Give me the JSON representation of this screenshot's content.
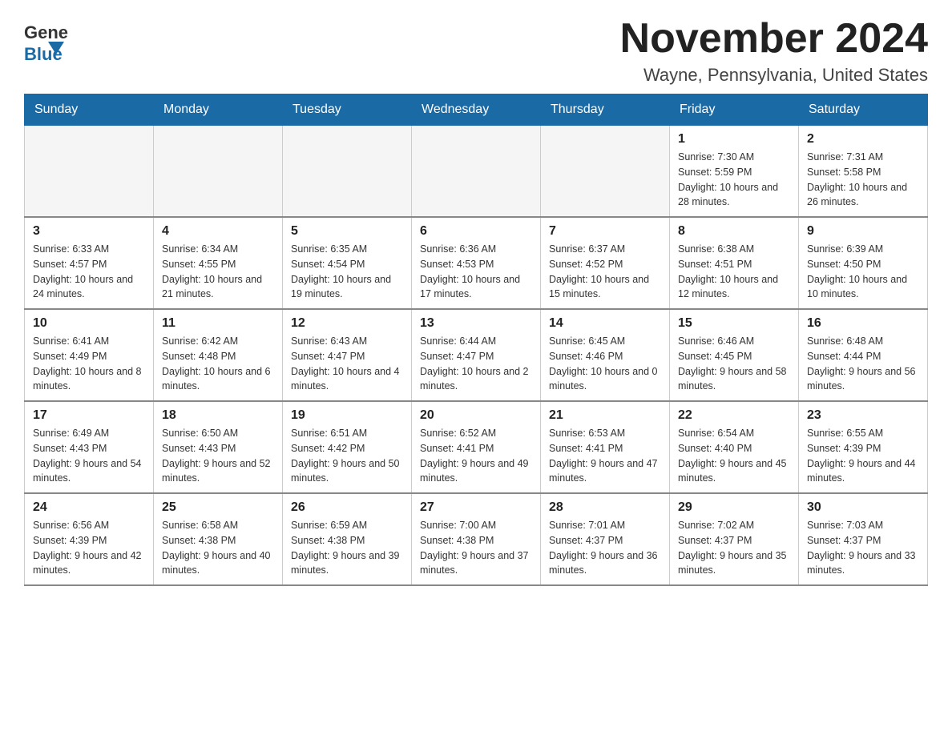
{
  "header": {
    "logo_general": "General",
    "logo_blue": "Blue",
    "month_title": "November 2024",
    "location": "Wayne, Pennsylvania, United States"
  },
  "days_of_week": [
    "Sunday",
    "Monday",
    "Tuesday",
    "Wednesday",
    "Thursday",
    "Friday",
    "Saturday"
  ],
  "weeks": [
    [
      {
        "day": "",
        "empty": true
      },
      {
        "day": "",
        "empty": true
      },
      {
        "day": "",
        "empty": true
      },
      {
        "day": "",
        "empty": true
      },
      {
        "day": "",
        "empty": true
      },
      {
        "day": "1",
        "sunrise": "7:30 AM",
        "sunset": "5:59 PM",
        "daylight": "10 hours and 28 minutes."
      },
      {
        "day": "2",
        "sunrise": "7:31 AM",
        "sunset": "5:58 PM",
        "daylight": "10 hours and 26 minutes."
      }
    ],
    [
      {
        "day": "3",
        "sunrise": "6:33 AM",
        "sunset": "4:57 PM",
        "daylight": "10 hours and 24 minutes."
      },
      {
        "day": "4",
        "sunrise": "6:34 AM",
        "sunset": "4:55 PM",
        "daylight": "10 hours and 21 minutes."
      },
      {
        "day": "5",
        "sunrise": "6:35 AM",
        "sunset": "4:54 PM",
        "daylight": "10 hours and 19 minutes."
      },
      {
        "day": "6",
        "sunrise": "6:36 AM",
        "sunset": "4:53 PM",
        "daylight": "10 hours and 17 minutes."
      },
      {
        "day": "7",
        "sunrise": "6:37 AM",
        "sunset": "4:52 PM",
        "daylight": "10 hours and 15 minutes."
      },
      {
        "day": "8",
        "sunrise": "6:38 AM",
        "sunset": "4:51 PM",
        "daylight": "10 hours and 12 minutes."
      },
      {
        "day": "9",
        "sunrise": "6:39 AM",
        "sunset": "4:50 PM",
        "daylight": "10 hours and 10 minutes."
      }
    ],
    [
      {
        "day": "10",
        "sunrise": "6:41 AM",
        "sunset": "4:49 PM",
        "daylight": "10 hours and 8 minutes."
      },
      {
        "day": "11",
        "sunrise": "6:42 AM",
        "sunset": "4:48 PM",
        "daylight": "10 hours and 6 minutes."
      },
      {
        "day": "12",
        "sunrise": "6:43 AM",
        "sunset": "4:47 PM",
        "daylight": "10 hours and 4 minutes."
      },
      {
        "day": "13",
        "sunrise": "6:44 AM",
        "sunset": "4:47 PM",
        "daylight": "10 hours and 2 minutes."
      },
      {
        "day": "14",
        "sunrise": "6:45 AM",
        "sunset": "4:46 PM",
        "daylight": "10 hours and 0 minutes."
      },
      {
        "day": "15",
        "sunrise": "6:46 AM",
        "sunset": "4:45 PM",
        "daylight": "9 hours and 58 minutes."
      },
      {
        "day": "16",
        "sunrise": "6:48 AM",
        "sunset": "4:44 PM",
        "daylight": "9 hours and 56 minutes."
      }
    ],
    [
      {
        "day": "17",
        "sunrise": "6:49 AM",
        "sunset": "4:43 PM",
        "daylight": "9 hours and 54 minutes."
      },
      {
        "day": "18",
        "sunrise": "6:50 AM",
        "sunset": "4:43 PM",
        "daylight": "9 hours and 52 minutes."
      },
      {
        "day": "19",
        "sunrise": "6:51 AM",
        "sunset": "4:42 PM",
        "daylight": "9 hours and 50 minutes."
      },
      {
        "day": "20",
        "sunrise": "6:52 AM",
        "sunset": "4:41 PM",
        "daylight": "9 hours and 49 minutes."
      },
      {
        "day": "21",
        "sunrise": "6:53 AM",
        "sunset": "4:41 PM",
        "daylight": "9 hours and 47 minutes."
      },
      {
        "day": "22",
        "sunrise": "6:54 AM",
        "sunset": "4:40 PM",
        "daylight": "9 hours and 45 minutes."
      },
      {
        "day": "23",
        "sunrise": "6:55 AM",
        "sunset": "4:39 PM",
        "daylight": "9 hours and 44 minutes."
      }
    ],
    [
      {
        "day": "24",
        "sunrise": "6:56 AM",
        "sunset": "4:39 PM",
        "daylight": "9 hours and 42 minutes."
      },
      {
        "day": "25",
        "sunrise": "6:58 AM",
        "sunset": "4:38 PM",
        "daylight": "9 hours and 40 minutes."
      },
      {
        "day": "26",
        "sunrise": "6:59 AM",
        "sunset": "4:38 PM",
        "daylight": "9 hours and 39 minutes."
      },
      {
        "day": "27",
        "sunrise": "7:00 AM",
        "sunset": "4:38 PM",
        "daylight": "9 hours and 37 minutes."
      },
      {
        "day": "28",
        "sunrise": "7:01 AM",
        "sunset": "4:37 PM",
        "daylight": "9 hours and 36 minutes."
      },
      {
        "day": "29",
        "sunrise": "7:02 AM",
        "sunset": "4:37 PM",
        "daylight": "9 hours and 35 minutes."
      },
      {
        "day": "30",
        "sunrise": "7:03 AM",
        "sunset": "4:37 PM",
        "daylight": "9 hours and 33 minutes."
      }
    ]
  ],
  "labels": {
    "sunrise_prefix": "Sunrise: ",
    "sunset_prefix": "Sunset: ",
    "daylight_prefix": "Daylight: "
  }
}
